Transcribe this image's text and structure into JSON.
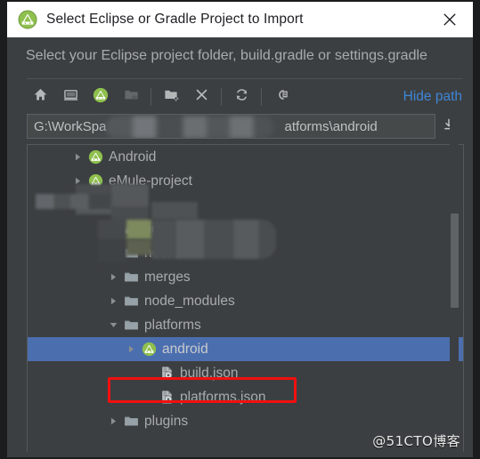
{
  "window": {
    "title": "Select Eclipse or Gradle Project to Import",
    "app_icon": "android-studio-icon",
    "close_label": "✕",
    "titlebar_bg": "#ffffff",
    "dialog_bg": "#3c3f41"
  },
  "dialog": {
    "subtitle": "Select your Eclipse project folder, build.gradle or settings.gradle"
  },
  "toolbar": {
    "buttons": [
      {
        "name": "home-icon",
        "tooltip": "Home",
        "enabled": true
      },
      {
        "name": "desktop-icon",
        "tooltip": "Desktop",
        "enabled": true
      },
      {
        "name": "android-project-icon",
        "tooltip": "Project Directory",
        "enabled": true
      },
      {
        "name": "folder-icon",
        "tooltip": "Module Directory",
        "enabled": false
      },
      {
        "name": "new-folder-icon",
        "tooltip": "New Folder",
        "enabled": true
      },
      {
        "name": "delete-icon",
        "tooltip": "Delete",
        "enabled": true
      },
      {
        "name": "refresh-icon",
        "tooltip": "Refresh",
        "enabled": true
      },
      {
        "name": "show-hidden-icon",
        "tooltip": "Show Hidden Files",
        "enabled": true
      }
    ],
    "hide_path_label": "Hide path",
    "hide_path_color": "#3e86d6"
  },
  "path_field": {
    "value_prefix": "G:\\WorkSpa",
    "value_suffix": "atforms\\android",
    "censored": true,
    "dropdown_icon": "download-arrow-icon"
  },
  "tree": {
    "rows": [
      {
        "label": "Android",
        "icon": "android-studio-icon",
        "arrow": "collapsed",
        "indent": 2,
        "selected": false
      },
      {
        "label": "eMule-project",
        "icon": "android-studio-icon",
        "arrow": "collapsed",
        "indent": 2,
        "selected": false
      },
      {
        "label": "cs",
        "icon": "folder-icon",
        "arrow": "collapsed",
        "indent": 3,
        "selected": false,
        "censored": true
      },
      {
        "label": ".idea",
        "icon": "folder-icon",
        "arrow": "collapsed",
        "indent": 4,
        "selected": false
      },
      {
        "label": "hooks",
        "icon": "folder-icon",
        "arrow": "collapsed",
        "indent": 4,
        "selected": false
      },
      {
        "label": "merges",
        "icon": "folder-icon",
        "arrow": "collapsed",
        "indent": 4,
        "selected": false
      },
      {
        "label": "node_modules",
        "icon": "folder-icon",
        "arrow": "collapsed",
        "indent": 4,
        "selected": false
      },
      {
        "label": "platforms",
        "icon": "folder-icon",
        "arrow": "expanded",
        "indent": 4,
        "selected": false
      },
      {
        "label": "android",
        "icon": "android-studio-icon",
        "arrow": "collapsed",
        "indent": 5,
        "selected": true
      },
      {
        "label": "build.json",
        "icon": "json-file-icon",
        "arrow": "none",
        "indent": 6,
        "selected": false
      },
      {
        "label": "platforms.json",
        "icon": "json-file-icon",
        "arrow": "none",
        "indent": 6,
        "selected": false
      },
      {
        "label": "plugins",
        "icon": "folder-icon",
        "arrow": "collapsed",
        "indent": 4,
        "selected": false
      }
    ],
    "selection_color": "#4b6eaf",
    "highlight_box_color": "#f20f0f",
    "highlight_box_target": "android"
  },
  "scrollbar": {
    "orientation": "vertical",
    "thumb_color": "#606366"
  },
  "watermark": {
    "text": "@51CTO博客"
  }
}
